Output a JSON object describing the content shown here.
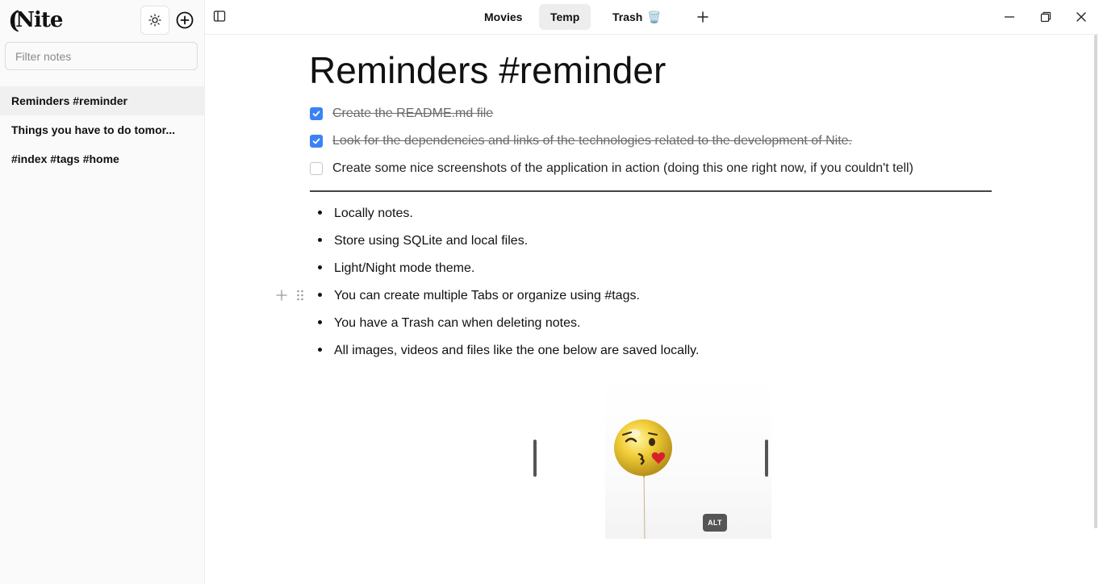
{
  "app": {
    "logo_text": "Nite"
  },
  "sidebar": {
    "filter": {
      "placeholder": "Filter notes",
      "value": ""
    },
    "notes": [
      {
        "label": "Reminders #reminder",
        "active": true
      },
      {
        "label": "Things you have to do tomor...",
        "active": false
      },
      {
        "label": "#index #tags #home",
        "active": false
      }
    ]
  },
  "tabs": [
    {
      "label": "Movies",
      "active": false
    },
    {
      "label": "Temp",
      "active": true
    },
    {
      "label": "Trash",
      "emoji": "🗑️",
      "active": false
    }
  ],
  "editor": {
    "title": "Reminders #reminder",
    "tasks": [
      {
        "text": "Create the README.md file",
        "checked": true
      },
      {
        "text": "Look for the dependencies and links of the technologies related to the development of Nite.",
        "checked": true
      },
      {
        "text": "Create some nice screenshots of the application in action (doing this one right now, if you couldn't tell)",
        "checked": false
      }
    ],
    "bullets": [
      "Locally notes.",
      "Store using SQLite and local files.",
      "Light/Night mode theme.",
      "You can create multiple Tabs or organize using #tags.",
      "You have a Trash can when deleting notes.",
      "All images, videos and files like the one below are saved locally."
    ],
    "image": {
      "alt_badge": "ALT",
      "subject": "kissing-face balloon"
    }
  },
  "colors": {
    "accent": "#3b82f6",
    "sidebar_bg": "#fafafa",
    "active_tab_bg": "#ededed"
  },
  "icons": [
    "sun-icon",
    "plus-circle-icon",
    "sidebar-toggle-icon",
    "plus-icon",
    "minimize-icon",
    "restore-icon",
    "close-icon",
    "drag-handle-icon",
    "check-icon"
  ]
}
